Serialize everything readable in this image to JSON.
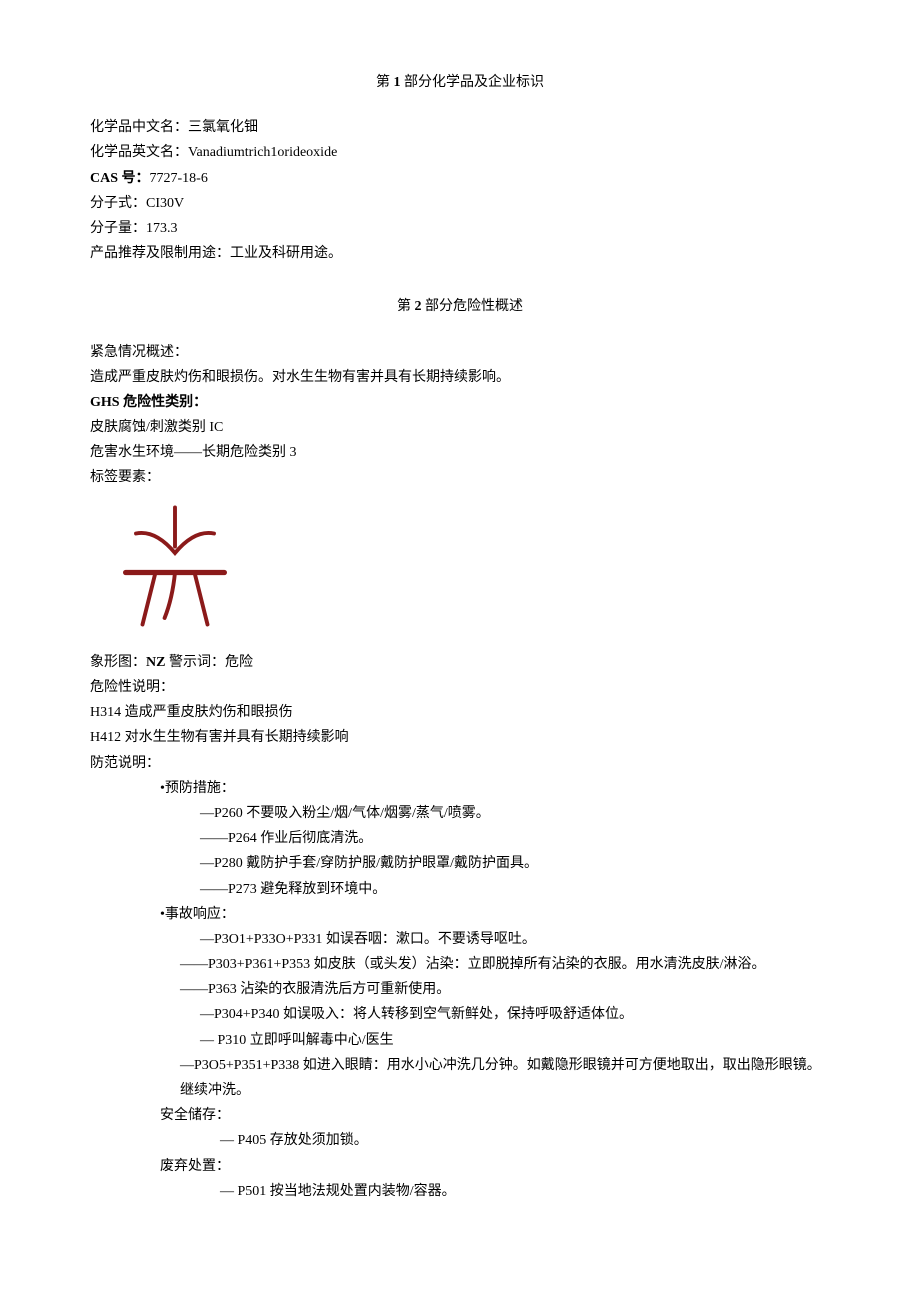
{
  "section1": {
    "title_prefix": "第 ",
    "title_num": "1",
    "title_suffix": " 部分化学品及企业标识",
    "name_cn_label": "化学品中文名：",
    "name_cn_value": "三氯氧化钿",
    "name_en_label": "化学品英文名：",
    "name_en_value": "Vanadiumtrich1orideoxide",
    "cas_label": "CAS 号：",
    "cas_value": "7727-18-6",
    "formula_label": "分子式：",
    "formula_value": "CI30V",
    "mw_label": "分子量：",
    "mw_value": "173.3",
    "use_label": "产品推荐及限制用途：",
    "use_value": "工业及科研用途。"
  },
  "section2": {
    "title_prefix": "第 ",
    "title_num": "2",
    "title_suffix": " 部分危险性概述",
    "emergency_label": "紧急情况概述：",
    "emergency_value": "造成严重皮肤灼伤和眼损伤。对水生生物有害并具有长期持续影响。",
    "ghs_label": "GHS 危险性类别：",
    "ghs_line1": "皮肤腐蚀/刺激类别 IC",
    "ghs_line2": "危害水生环境——长期危险类别 3",
    "label_elements": "标签要素：",
    "pictogram_label": "象形图：",
    "pictogram_code": "NZ",
    "signal_label": " 警示词：",
    "signal_value": "危险",
    "hazard_label": "危险性说明：",
    "h314": "H314 造成严重皮肤灼伤和眼损伤",
    "h412": "H412 对水生生物有害并具有长期持续影响",
    "precaution_label": "防范说明：",
    "prevention_label": "•预防措施：",
    "p260": "—P260 不要吸入粉尘/烟/气体/烟雾/蒸气/喷雾。",
    "p264": "——P264 作业后彻底清洗。",
    "p280": "—P280 戴防护手套/穿防护服/戴防护眼罩/戴防护面具。",
    "p273": "——P273 避免释放到环境中。",
    "response_label": "•事故响应：",
    "p301": "—P3O1+P33O+P331 如误吞咽：漱口。不要诱导呕吐。",
    "p303": "——P303+P361+P353 如皮肤（或头发）沾染：立即脱掉所有沾染的衣服。用水清洗皮肤/淋浴。",
    "p363": "——P363 沾染的衣服清洗后方可重新使用。",
    "p304": "—P304+P340 如误吸入：将人转移到空气新鲜处，保持呼吸舒适体位。",
    "p310": "—   P310 立即呼叫解毒中心/医生",
    "p305": "—P3O5+P351+P338 如进入眼睛：用水小心冲洗几分钟。如戴隐形眼镜并可方便地取出，取出隐形眼镜。继续冲洗。",
    "storage_label": "安全储存：",
    "p405": "—   P405 存放处须加锁。",
    "disposal_label": "废弃处置：",
    "p501": "—   P501 按当地法规处置内装物/容器。"
  }
}
